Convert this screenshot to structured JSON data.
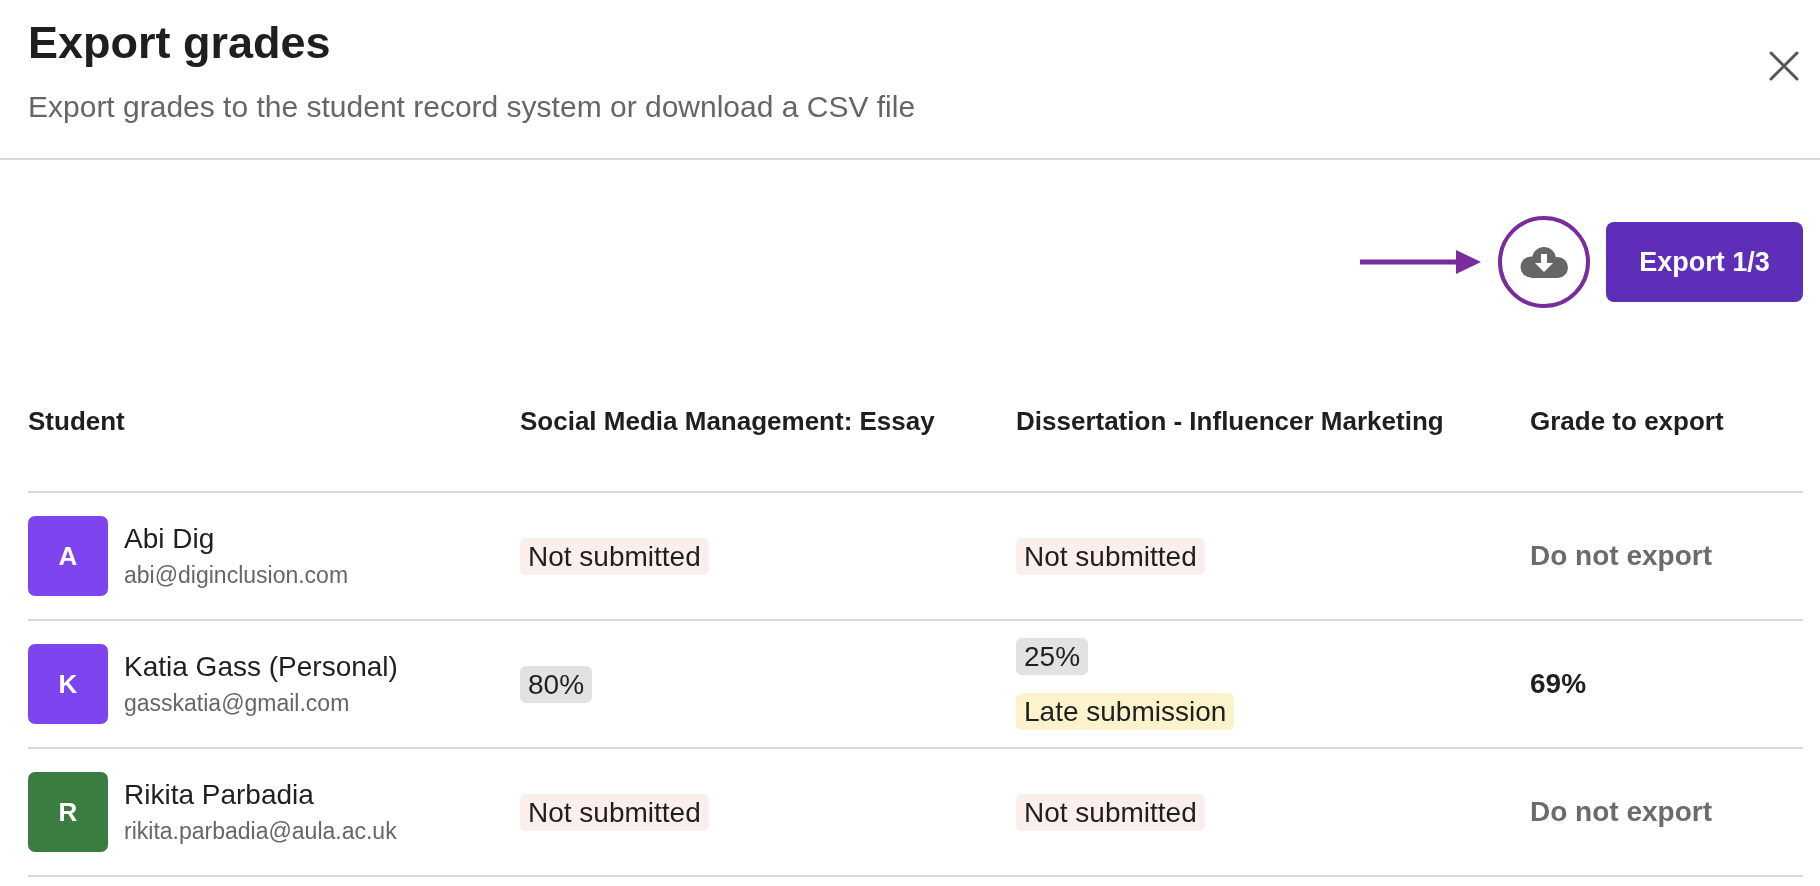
{
  "dialog": {
    "title": "Export grades",
    "subtitle": "Export grades to the student record system or download a CSV file"
  },
  "toolbar": {
    "export_button": "Export 1/3"
  },
  "table": {
    "columns": [
      "Student",
      "Social Media Management: Essay",
      "Dissertation - Influencer Marketing",
      "Grade to export"
    ],
    "rows": [
      {
        "student": {
          "initial": "A",
          "color": "#7e44ef",
          "name": "Abi Dig",
          "email": "abi@diginclusion.com"
        },
        "assignments": [
          [
            {
              "kind": "missing",
              "text": "Not submitted"
            }
          ],
          [
            {
              "kind": "missing",
              "text": "Not submitted"
            }
          ]
        ],
        "export": {
          "kind": "excluded",
          "text": "Do not export"
        }
      },
      {
        "student": {
          "initial": "K",
          "color": "#7e44ef",
          "name": "Katia Gass (Personal)",
          "email": "gasskatia@gmail.com"
        },
        "assignments": [
          [
            {
              "kind": "grade",
              "text": "80%"
            }
          ],
          [
            {
              "kind": "grade",
              "text": "25%"
            },
            {
              "kind": "late",
              "text": "Late submission"
            }
          ]
        ],
        "export": {
          "kind": "grade",
          "text": "69%"
        }
      },
      {
        "student": {
          "initial": "R",
          "color": "#3b7d40",
          "name": "Rikita Parbadia",
          "email": "rikita.parbadia@aula.ac.uk"
        },
        "assignments": [
          [
            {
              "kind": "missing",
              "text": "Not submitted"
            }
          ],
          [
            {
              "kind": "missing",
              "text": "Not submitted"
            }
          ]
        ],
        "export": {
          "kind": "excluded",
          "text": "Do not export"
        }
      }
    ]
  }
}
